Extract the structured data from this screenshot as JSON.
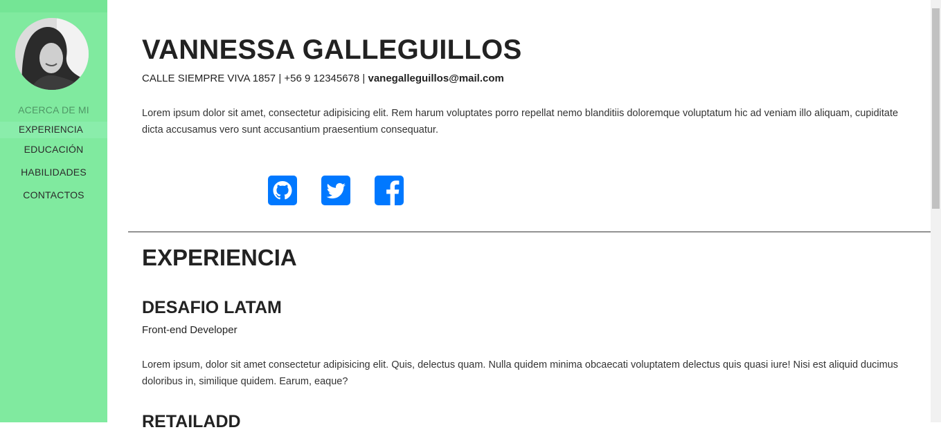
{
  "sidebar": {
    "nav": [
      {
        "label": "ACERCA DE MI"
      },
      {
        "label": "EXPERIENCIA"
      },
      {
        "label": "EDUCACIÓN"
      },
      {
        "label": "HABILIDADES"
      },
      {
        "label": "CONTACTOS"
      }
    ],
    "active_index": 1,
    "colors": {
      "background": "#80ea9f",
      "active": "#8aedab"
    }
  },
  "header": {
    "name": "VANNESSA GALLEGUILLOS",
    "contact_prefix": "CALLE SIEMPRE VIVA 1857 | +56 9 12345678 | ",
    "email": "vanegalleguillos@mail.com",
    "intro": "Lorem ipsum dolor sit amet, consectetur adipisicing elit. Rem harum voluptates porro repellat nemo blanditiis doloremque voluptatum hic ad veniam illo aliquam, cupiditate dicta accusamus vero sunt accusantium praesentium consequatur."
  },
  "social": {
    "icons": [
      "github-icon",
      "twitter-icon",
      "facebook-icon"
    ],
    "color": "#0078ff"
  },
  "experience": {
    "title": "EXPERIENCIA",
    "jobs": [
      {
        "company": "DESAFIO LATAM",
        "role": "Front-end Developer",
        "description": "Lorem ipsum, dolor sit amet consectetur adipisicing elit. Quis, delectus quam. Nulla quidem minima obcaecati voluptatem delectus quis quasi iure! Nisi est aliquid ducimus doloribus in, similique quidem. Earum, eaque?"
      },
      {
        "company": "RETAILADD"
      }
    ]
  }
}
